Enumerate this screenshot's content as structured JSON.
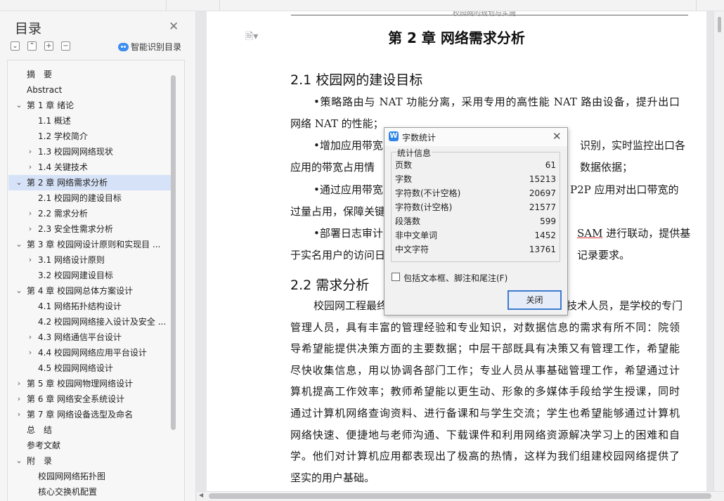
{
  "toc": {
    "title": "目录",
    "smart_label": "智能识别目录",
    "buttons": [
      "⌄",
      "⌃",
      "+",
      "−"
    ],
    "items": [
      {
        "label": "摘　要",
        "level": 0,
        "chev": "",
        "active": false
      },
      {
        "label": "Abstract",
        "level": 0,
        "chev": "",
        "active": false
      },
      {
        "label": "第 1 章  绪论",
        "level": 0,
        "chev": "⌄",
        "active": false
      },
      {
        "label": "1.1 概述",
        "level": 1,
        "chev": "",
        "active": false
      },
      {
        "label": "1.2 学校简介",
        "level": 1,
        "chev": "",
        "active": false
      },
      {
        "label": "1.3 校园网网络现状",
        "level": 1,
        "chev": "›",
        "active": false
      },
      {
        "label": "1.4  关键技术",
        "level": 1,
        "chev": "›",
        "active": false
      },
      {
        "label": "第 2 章  网络需求分析",
        "level": 0,
        "chev": "⌄",
        "active": true
      },
      {
        "label": "2.1 校园网的建设目标",
        "level": 1,
        "chev": "",
        "active": false
      },
      {
        "label": "2.2 需求分析",
        "level": 1,
        "chev": "›",
        "active": false
      },
      {
        "label": "2.3 安全性需求分析",
        "level": 1,
        "chev": "›",
        "active": false
      },
      {
        "label": "第 3 章  校园网设计原则和实现目 ...",
        "level": 0,
        "chev": "⌄",
        "active": false
      },
      {
        "label": "3.1 网络设计原则",
        "level": 1,
        "chev": "›",
        "active": false
      },
      {
        "label": "3.2 校园网建设目标",
        "level": 1,
        "chev": "",
        "active": false
      },
      {
        "label": "第 4 章  校园网总体方案设计",
        "level": 0,
        "chev": "⌄",
        "active": false
      },
      {
        "label": "4.1  网络拓扑结构设计",
        "level": 1,
        "chev": "",
        "active": false
      },
      {
        "label": "4.2  校园网网络接入设计及安全 ...",
        "level": 1,
        "chev": "",
        "active": false
      },
      {
        "label": "4.3  网络通信平台设计",
        "level": 1,
        "chev": "›",
        "active": false
      },
      {
        "label": "4.4  校园网网络应用平台设计",
        "level": 1,
        "chev": "›",
        "active": false
      },
      {
        "label": "4.5 校园网网络设计",
        "level": 1,
        "chev": "",
        "active": false
      },
      {
        "label": "第 5 章  校园网物理网络设计",
        "level": 0,
        "chev": "›",
        "active": false
      },
      {
        "label": "第 6 章  网络安全系统设计",
        "level": 0,
        "chev": "›",
        "active": false
      },
      {
        "label": "第 7 章  网络设备选型及命名",
        "level": 0,
        "chev": "›",
        "active": false
      },
      {
        "label": "总　结",
        "level": 0,
        "chev": "",
        "active": false
      },
      {
        "label": "参考文献",
        "level": 0,
        "chev": "",
        "active": false
      },
      {
        "label": "附　录",
        "level": 0,
        "chev": "⌄",
        "active": false
      },
      {
        "label": "校园网网络拓扑图",
        "level": 1,
        "chev": "",
        "active": false
      },
      {
        "label": "核心交换机配置",
        "level": 1,
        "chev": "",
        "active": false
      }
    ]
  },
  "document": {
    "header": "校园网的规划与实施",
    "chapter_title": "第 2 章  网络需求分析",
    "section1": "2.1 校园网的建设目标",
    "section2": "2.2 需求分析",
    "p1a": "•策略路由与 NAT 功能分离，采用专用的高性能 NAT 路由设备，提升出口",
    "p1b": "网络 NAT 的性能；",
    "p2a_left": "•增加应用带宽",
    "p2a_right": "识别，实时监控出口各",
    "p2b_left": "应用的带宽占用情",
    "p2b_right": "数据依据；",
    "p3a_left": "•通过应用带宽",
    "p3a_right": "P2P 应用对出口带宽的",
    "p3b": "过量占用，保障关键",
    "p4a_left": "•部署日志审计",
    "p4a_ul": "SAM",
    "p4a_right": " 进行联动，提供基",
    "p4b_left": "于实名用户的访问日",
    "p4b_right": "记录要求。",
    "q1_left": "校园网工程最终",
    "q1_right": "技术人员，是学校的专门",
    "q2": "管理人员，具有丰富的管理经验和专业知识，对数据信息的需求有所不同：院领",
    "q3": "导希望能提供决策方面的主要数据；中层干部既具有决策又有管理工作，希望能",
    "q4": "尽快收集信息，用以协调各部门工作；专业人员从事基础管理工作，希望通过计",
    "q5": "算机提高工作效率；教师希望能以更生动、形象的多媒体手段给学生授课，同时",
    "q6": "通过计算机网络查询资料、进行备课和与学生交流；学生也希望能够通过计算机",
    "q7": "网络快速、便捷地与老师沟通、下载课件和利用网络资源解决学习上的困难和自",
    "q8": "学。他们对计算机应用都表现出了极高的热情，这样为我们组建校园网络提供了",
    "q9": "坚实的用户基础。"
  },
  "dialog": {
    "title": "字数统计",
    "group_label": "统计信息",
    "stats": [
      {
        "k": "页数",
        "v": "61"
      },
      {
        "k": "字数",
        "v": "15213"
      },
      {
        "k": "字符数(不计空格)",
        "v": "20697"
      },
      {
        "k": "字符数(计空格)",
        "v": "21577"
      },
      {
        "k": "段落数",
        "v": "599"
      },
      {
        "k": "非中文单词",
        "v": "1452"
      },
      {
        "k": "中文字符",
        "v": "13761"
      }
    ],
    "checkbox_label": "包括文本框、脚注和尾注(F)",
    "close_button": "关闭"
  }
}
